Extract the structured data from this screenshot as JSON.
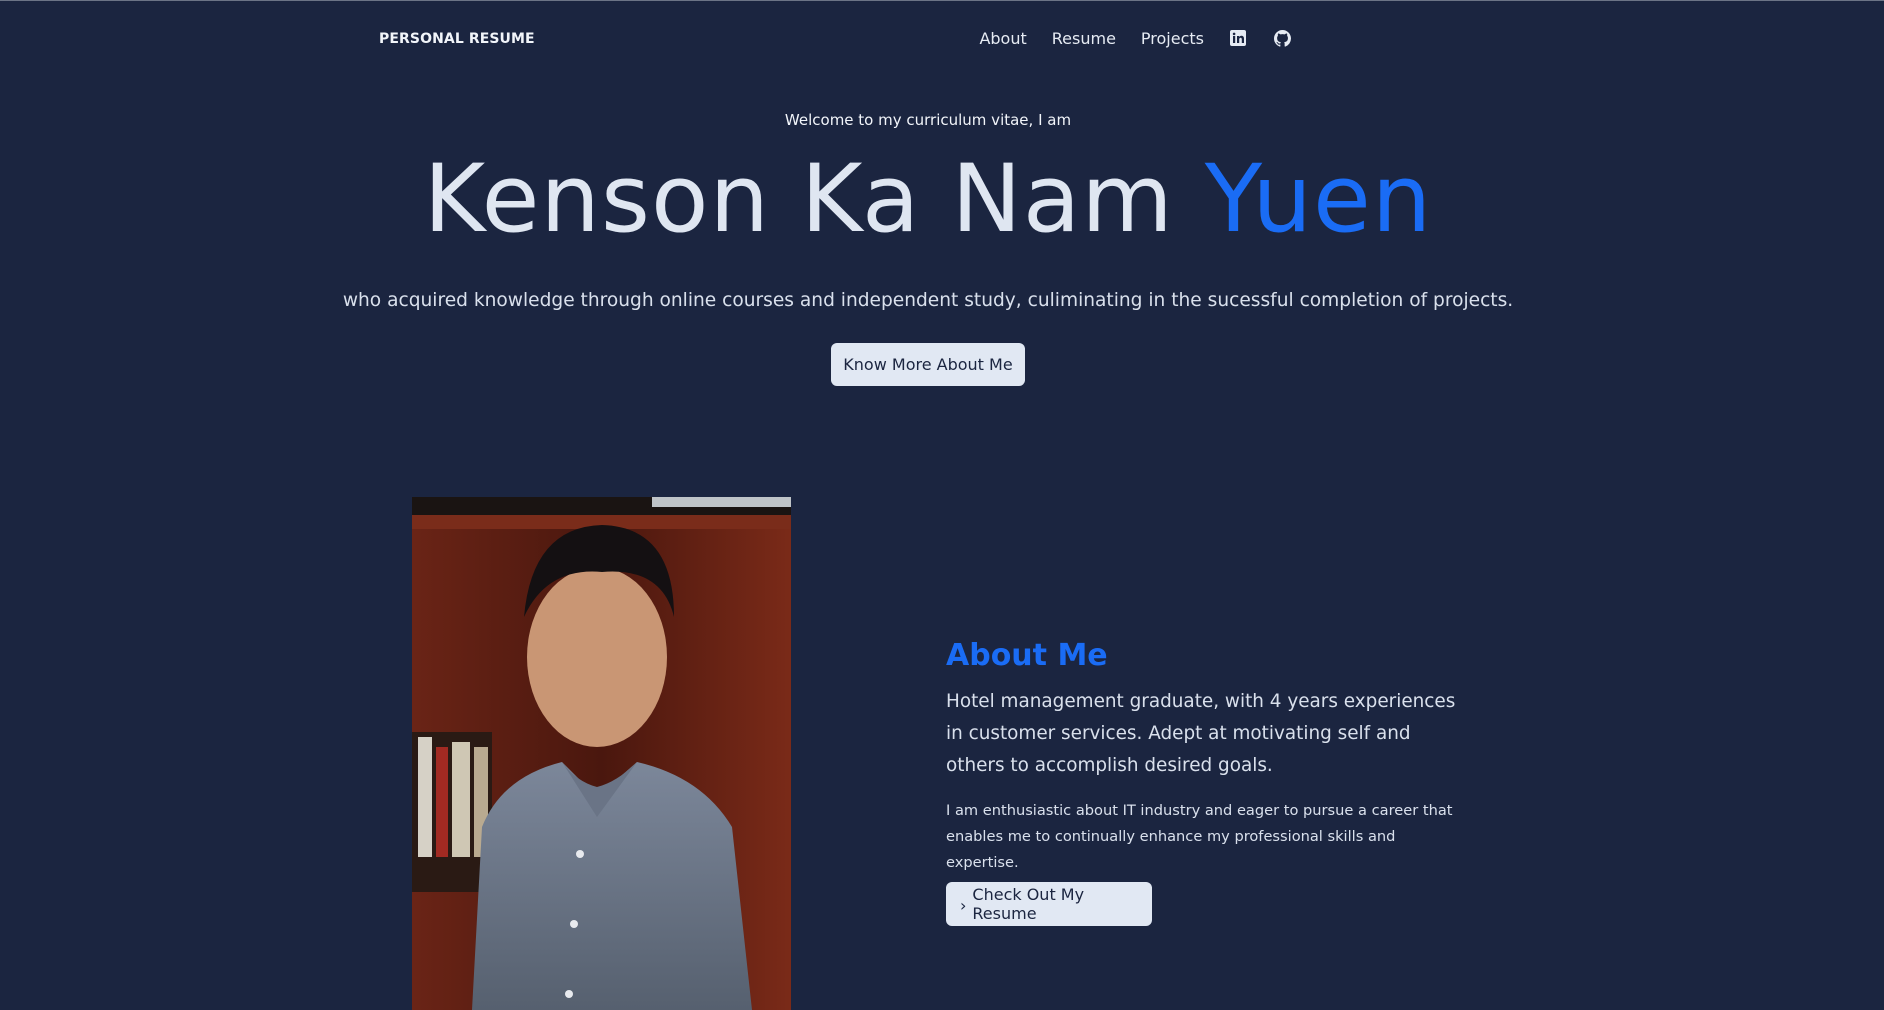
{
  "nav": {
    "brand": "PERSONAL RESUME",
    "links": [
      "About",
      "Resume",
      "Projects"
    ],
    "icons": [
      "linkedin-icon",
      "github-icon"
    ]
  },
  "hero": {
    "greeting": "Welcome to my curriculum vitae, I am",
    "name_first": "Kenson Ka Nam ",
    "name_last": "Yuen",
    "description": "who acquired knowledge through online courses and independent study, culiminating in the sucessful completion of projects.",
    "button_label": "Know More About Me"
  },
  "about": {
    "title": "About Me",
    "lead": "Hotel management graduate, with 4 years experiences in customer services. Adept at motivating self and others to accomplish desired goals.",
    "body": "I am enthusiastic about IT industry and eager to pursue a career that enables me to continually enhance my professional skills and expertise.",
    "button_label": "Check Out My Resume"
  },
  "colors": {
    "background": "#1b2540",
    "accent": "#1a6cf5",
    "button_bg": "#e1e8f3"
  }
}
